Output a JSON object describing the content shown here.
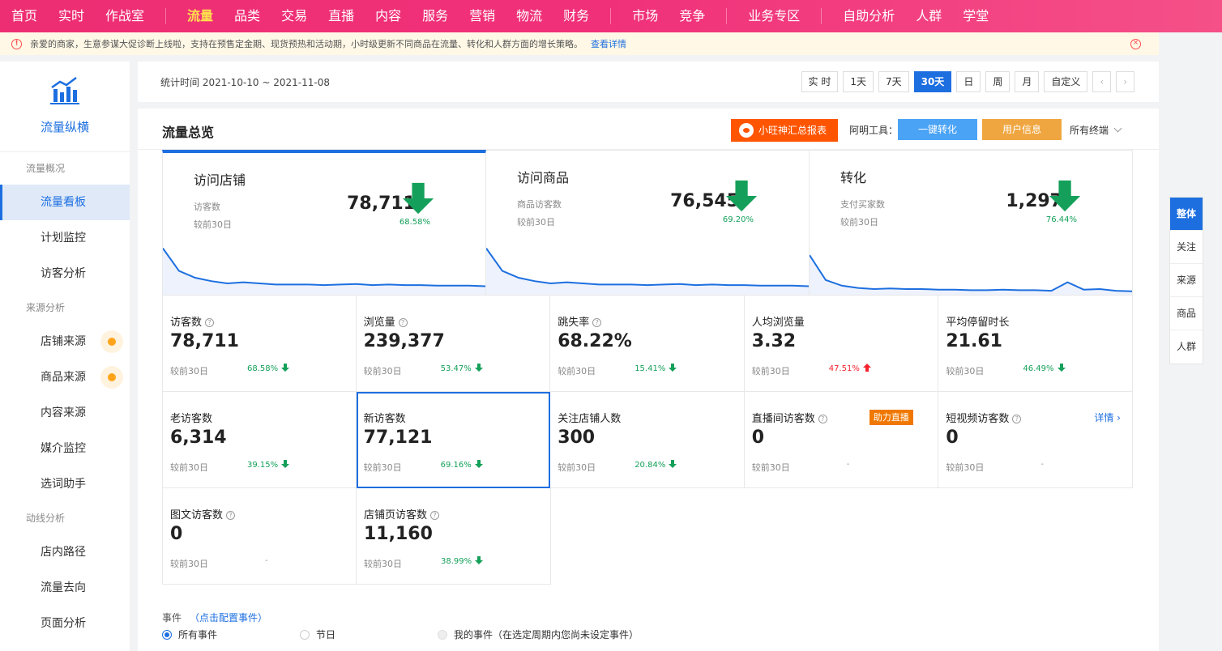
{
  "topnav": {
    "items": [
      {
        "label": "首页"
      },
      {
        "label": "实时"
      },
      {
        "label": "作战室"
      },
      {
        "label": "流量",
        "active": true
      },
      {
        "label": "品类",
        "dot": true
      },
      {
        "label": "交易"
      },
      {
        "label": "直播"
      },
      {
        "label": "内容"
      },
      {
        "label": "服务",
        "dot": true
      },
      {
        "label": "营销"
      },
      {
        "label": "物流"
      },
      {
        "label": "财务"
      },
      {
        "label": "市场"
      },
      {
        "label": "竞争"
      },
      {
        "label": "业务专区"
      },
      {
        "label": "自助分析",
        "dot": true
      },
      {
        "label": "人群"
      },
      {
        "label": "学堂"
      }
    ]
  },
  "notice": {
    "text": "亲爱的商家，生意参谋大促诊断上线啦，支持在预售定金期、现货预热和活动期，小时级更新不同商品在流量、转化和人群方面的增长策略。",
    "link": "查看详情"
  },
  "sidebar": {
    "brand": "流量纵横",
    "groups": [
      {
        "title": "流量概况",
        "items": [
          {
            "label": "流量看板",
            "active": true
          },
          {
            "label": "计划监控"
          },
          {
            "label": "访客分析"
          }
        ]
      },
      {
        "title": "来源分析",
        "items": [
          {
            "label": "店铺来源",
            "badge": true
          },
          {
            "label": "商品来源",
            "badge": true
          },
          {
            "label": "内容来源"
          },
          {
            "label": "媒介监控"
          },
          {
            "label": "选词助手"
          }
        ]
      },
      {
        "title": "动线分析",
        "items": [
          {
            "label": "店内路径"
          },
          {
            "label": "流量去向"
          },
          {
            "label": "页面分析"
          }
        ]
      }
    ]
  },
  "datebar": {
    "range": "统计时间 2021-10-10 ~ 2021-11-08",
    "buttons": [
      "实 时",
      "1天",
      "7天",
      "30天",
      "日",
      "周",
      "月",
      "自定义"
    ],
    "active": "30天",
    "prev": "‹",
    "next": "›"
  },
  "panel": {
    "title": "流量总览",
    "report_btn": "小旺神汇总报表",
    "tools_label": "阿明工具：",
    "tool_convert": "一键转化",
    "tool_user": "用户信息",
    "terminal": "所有终端"
  },
  "overview": [
    {
      "title": "访问店铺",
      "label": "访客数",
      "value": "78,711",
      "cmp": "较前30日",
      "pct": "68.58%",
      "trend": [
        82,
        42,
        30,
        24,
        20,
        22,
        20,
        18,
        18,
        18,
        17,
        18,
        19,
        17,
        18,
        17,
        17,
        16,
        16,
        16,
        15
      ],
      "active": true
    },
    {
      "title": "访问商品",
      "label": "商品访客数",
      "value": "76,545",
      "cmp": "较前30日",
      "pct": "69.20%",
      "trend": [
        82,
        42,
        30,
        24,
        20,
        22,
        20,
        18,
        18,
        18,
        17,
        18,
        19,
        17,
        18,
        17,
        17,
        16,
        16,
        16,
        15
      ]
    },
    {
      "title": "转化",
      "label": "支付买家数",
      "value": "1,297",
      "cmp": "较前30日",
      "pct": "76.44%",
      "trend": [
        70,
        26,
        16,
        12,
        10,
        11,
        10,
        10,
        9,
        9,
        8,
        8,
        9,
        8,
        8,
        7,
        22,
        9,
        10,
        7,
        6
      ]
    }
  ],
  "metrics": [
    [
      {
        "name": "访客数",
        "help": true,
        "value": "78,711",
        "cmp": "较前30日",
        "pct": "68.58%",
        "dir": "down"
      },
      {
        "name": "浏览量",
        "help": true,
        "value": "239,377",
        "cmp": "较前30日",
        "pct": "53.47%",
        "dir": "down"
      },
      {
        "name": "跳失率",
        "help": true,
        "value": "68.22%",
        "cmp": "较前30日",
        "pct": "15.41%",
        "dir": "down"
      },
      {
        "name": "人均浏览量",
        "help": false,
        "value": "3.32",
        "cmp": "较前30日",
        "pct": "47.51%",
        "dir": "up"
      },
      {
        "name": "平均停留时长",
        "help": false,
        "value": "21.61",
        "cmp": "较前30日",
        "pct": "46.49%",
        "dir": "down"
      }
    ],
    [
      {
        "name": "老访客数",
        "help": false,
        "value": "6,314",
        "cmp": "较前30日",
        "pct": "39.15%",
        "dir": "down"
      },
      {
        "name": "新访客数",
        "help": false,
        "value": "77,121",
        "cmp": "较前30日",
        "pct": "69.16%",
        "dir": "down",
        "selected": true
      },
      {
        "name": "关注店铺人数",
        "help": false,
        "value": "300",
        "cmp": "较前30日",
        "pct": "20.84%",
        "dir": "down"
      },
      {
        "name": "直播间访客数",
        "help": true,
        "value": "0",
        "cmp": "较前30日",
        "pct": "-",
        "dir": "flat",
        "badge": "助力直播"
      },
      {
        "name": "短视频访客数",
        "help": true,
        "value": "0",
        "cmp": "较前30日",
        "pct": "-",
        "dir": "flat",
        "details": "详情"
      }
    ],
    [
      {
        "name": "图文访客数",
        "help": true,
        "value": "0",
        "cmp": "较前30日",
        "pct": "-",
        "dir": "flat"
      },
      {
        "name": "店铺页访客数",
        "help": true,
        "value": "11,160",
        "cmp": "较前30日",
        "pct": "38.99%",
        "dir": "down"
      }
    ]
  ],
  "events": {
    "label": "事件",
    "config": "（点击配置事件）",
    "options": [
      {
        "label": "所有事件",
        "checked": true
      },
      {
        "label": "节日"
      },
      {
        "label": "我的事件（在选定周期内您尚未设定事件）",
        "disabled": true
      }
    ]
  },
  "sidetabs": [
    {
      "label": "整体",
      "active": true
    },
    {
      "label": "关注"
    },
    {
      "label": "来源"
    },
    {
      "label": "商品"
    },
    {
      "label": "人群"
    }
  ],
  "colors": {
    "accent": "#1d6fe0",
    "brand": "#ee2e72",
    "down": "#14a05a",
    "up": "#f5222d"
  }
}
